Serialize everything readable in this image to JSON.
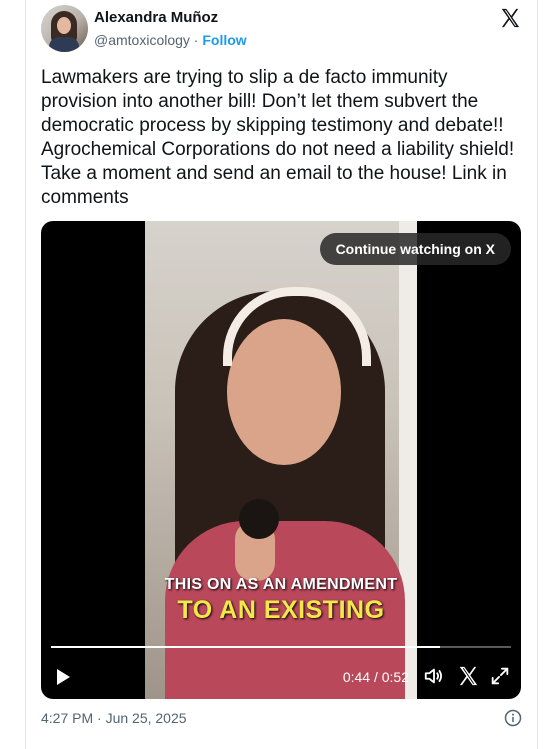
{
  "tweet": {
    "author_name": "Alexandra Muñoz",
    "handle": "@amtoxicology",
    "separator": " · ",
    "follow_label": "Follow",
    "text": "Lawmakers are trying to slip a de facto immunity provision into another bill!  Don’t let them subvert the democratic process by skipping testimony and debate!! Agrochemical Corporations do not need a liability shield! Take a moment and send an email to the house! Link in comments",
    "timestamp": "4:27 PM · Jun 25, 2025"
  },
  "video": {
    "continue_label": "Continue watching on X",
    "caption_line1": "THIS ON AS AN AMENDMENT",
    "caption_line2": "TO AN EXISTING",
    "time_display": "0:44 / 0:52",
    "progress_fraction": 0.846
  },
  "colors": {
    "follow": "#1d9bf0",
    "caption_highlight": "#f3e84a"
  },
  "icons": {
    "logo": "x-logo-icon",
    "play": "play-icon",
    "volume": "volume-icon",
    "x_small": "x-logo-icon",
    "fullscreen": "fullscreen-icon",
    "info": "info-icon"
  }
}
